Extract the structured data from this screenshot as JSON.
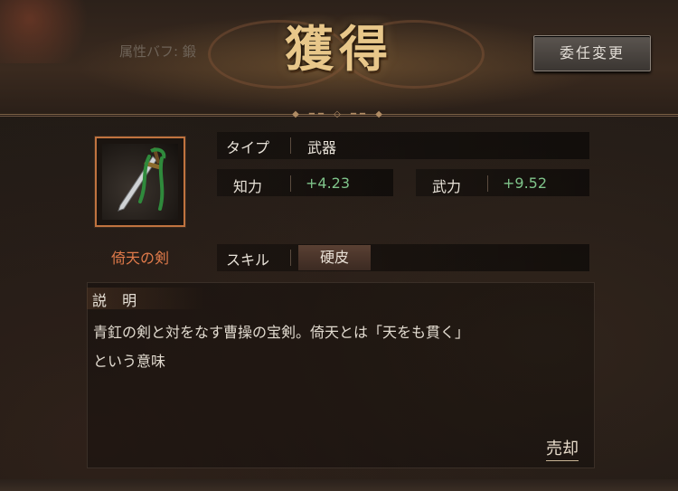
{
  "header": {
    "title": "獲得",
    "attribute_buff": "属性バフ: 鍛",
    "delegate_button": "委任変更"
  },
  "item": {
    "name": "倚天の剣",
    "icon": "sword-icon"
  },
  "stats": {
    "type_label": "タイプ",
    "type_value": "武器",
    "int_label": "知力",
    "int_value": "+4.23",
    "str_label": "武力",
    "str_value": "+9.52",
    "skill_label": "スキル",
    "skill_value": "硬皮"
  },
  "description": {
    "title": "説 明",
    "line1": "青釭の剣と対をなす曹操の宝剣。倚天とは「天をも貫く」",
    "line2": "という意味"
  },
  "actions": {
    "sell": "売却"
  },
  "colors": {
    "title_gold": "#e8c78a",
    "item_name": "#e07a4a",
    "stat_green": "#7fc48a",
    "frame_orange": "#c0733f"
  }
}
